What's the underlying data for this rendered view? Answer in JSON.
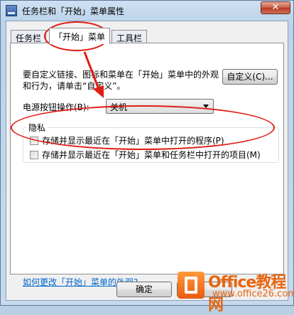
{
  "window": {
    "title": "任务栏和「开始」菜单属性",
    "close_glyph": "✕"
  },
  "tabs": [
    {
      "label": "任务栏"
    },
    {
      "label": "「开始」菜单",
      "active": true
    },
    {
      "label": "工具栏"
    }
  ],
  "start_menu": {
    "description": "要自定义链接、图标和菜单在「开始」菜单中的外观和行为，请单击“自定义”。",
    "customize_button": "自定义(C)...",
    "power_label": "电源按钮操作(B):",
    "power_value": "关机",
    "privacy": {
      "title": "隐私",
      "store_programs": "存储并显示最近在「开始」菜单中打开的程序(P)",
      "store_items": "存储并显示最近在「开始」菜单和任务栏中打开的项目(M)"
    },
    "help_link": "如何更改「开始」菜单的外观?"
  },
  "footer": {
    "ok_button": "确定"
  },
  "watermark": {
    "title": "Office教程网",
    "url": "www.office26.com"
  },
  "colors": {
    "highlight": "#e11d14",
    "link": "#0066cc",
    "watermark": "#e8650f"
  }
}
